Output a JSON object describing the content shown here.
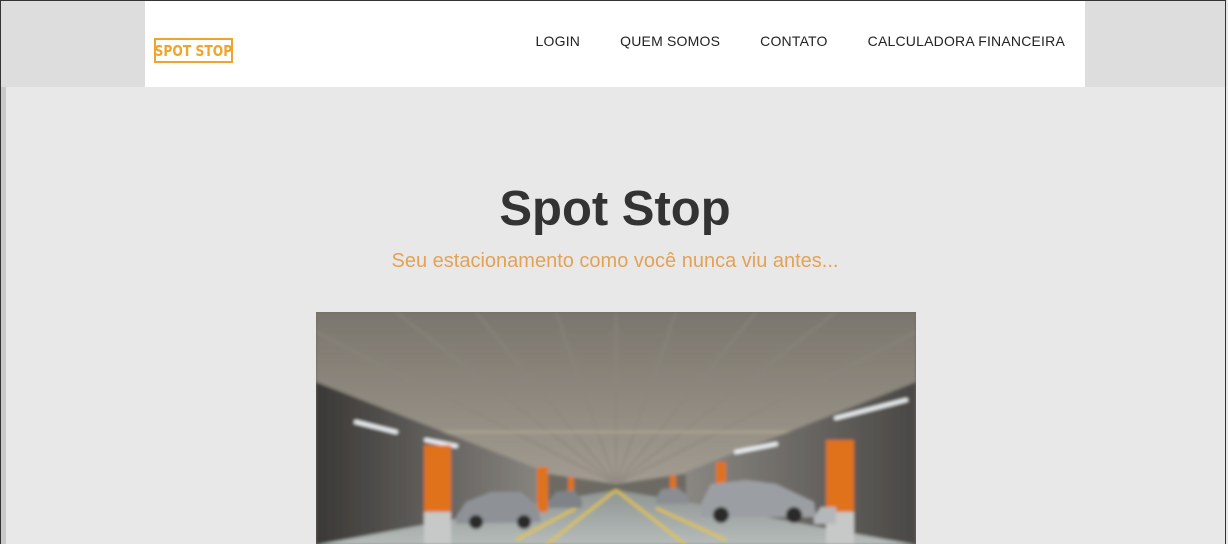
{
  "header": {
    "logo_text": "SPOT STOP",
    "nav": [
      {
        "label": "LOGIN"
      },
      {
        "label": "QUEM SOMOS"
      },
      {
        "label": "CONTATO"
      },
      {
        "label": "CALCULADORA FINANCEIRA"
      }
    ]
  },
  "hero": {
    "title": "Spot Stop",
    "subtitle": "Seu estacionamento como você nunca viu antes..."
  },
  "colors": {
    "accent": "#f0a42b",
    "subtitle": "#e3a256",
    "page_bg": "#e8e8e8",
    "title": "#333333"
  }
}
